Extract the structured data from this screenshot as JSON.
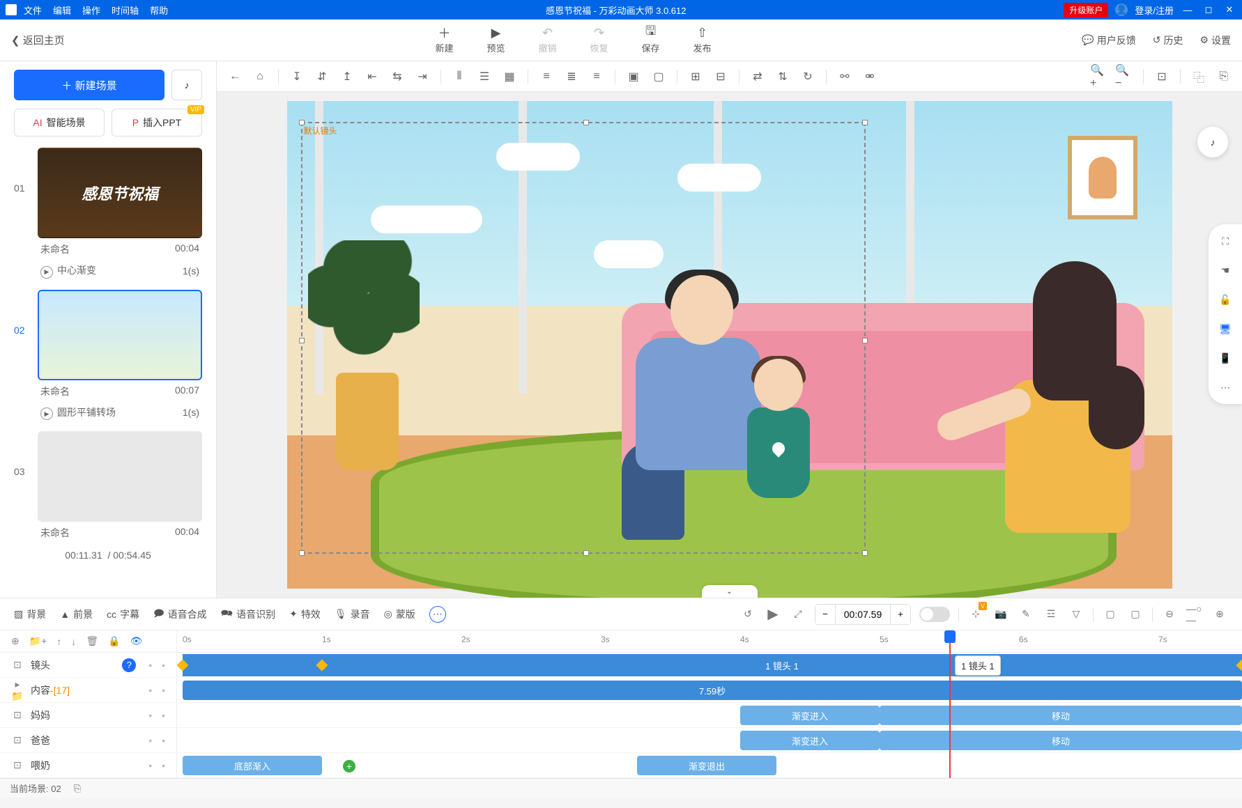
{
  "titlebar": {
    "menus": [
      "文件",
      "编辑",
      "操作",
      "时间轴",
      "帮助"
    ],
    "title": "感恩节祝福 - 万彩动画大师 3.0.612",
    "upgrade": "升级账户",
    "login": "登录/注册"
  },
  "toptool": {
    "back": "返回主页",
    "buttons": [
      {
        "icon": "＋",
        "label": "新建"
      },
      {
        "icon": "▶",
        "label": "预览"
      },
      {
        "icon": "↶",
        "label": "撤销",
        "disabled": true
      },
      {
        "icon": "↷",
        "label": "恢复",
        "disabled": true
      },
      {
        "icon": "🖫",
        "label": "保存"
      },
      {
        "icon": "⇧",
        "label": "发布"
      }
    ],
    "right": [
      {
        "icon": "💬",
        "label": "用户反馈"
      },
      {
        "icon": "↺",
        "label": "历史"
      },
      {
        "icon": "⚙",
        "label": "设置"
      }
    ]
  },
  "sidebar": {
    "newscene": "新建场景",
    "smart": "智能场景",
    "ppt": "插入PPT",
    "vip": "VIP",
    "scenes": [
      {
        "num": "01",
        "name": "未命名",
        "time": "00:04",
        "thumb_text": "感恩节祝福",
        "trans": "中心渐变",
        "trans_time": "1(s)"
      },
      {
        "num": "02",
        "name": "未命名",
        "time": "00:07",
        "trans": "圆形平铺转场",
        "trans_time": "1(s)",
        "active": true
      },
      {
        "num": "03",
        "name": "未命名",
        "time": "00:04"
      }
    ],
    "cur_time": "00:11.31",
    "total_time": "00:54.45"
  },
  "canvas": {
    "sel_label": "默认镜头"
  },
  "btoolbar": {
    "items": [
      "背景",
      "前景",
      "字幕",
      "语音合成",
      "语音识别",
      "特效",
      "录音",
      "蒙版"
    ],
    "time": "00:07.59"
  },
  "timeline": {
    "tracks": [
      {
        "icon": "⊡",
        "name": "镜头",
        "help": true
      },
      {
        "icon": "📁",
        "name": "内容",
        "badge": "-[17]"
      },
      {
        "icon": "⊡",
        "name": "妈妈"
      },
      {
        "icon": "⊡",
        "name": "爸爸"
      },
      {
        "icon": "⊡",
        "name": "喂奶"
      }
    ],
    "ruler": [
      "0s",
      "1s",
      "2s",
      "3s",
      "4s",
      "5s",
      "6s",
      "7s"
    ],
    "camera_clip": "1 镜头 1",
    "duration_clip": "7.59秒",
    "playhead_tip": "1 镜头 1",
    "fade_in": "渐变进入",
    "move": "移动",
    "bottom_enter": "底部渐入",
    "fade_out": "渐变退出"
  },
  "status": {
    "scene": "当前场景: 02"
  }
}
